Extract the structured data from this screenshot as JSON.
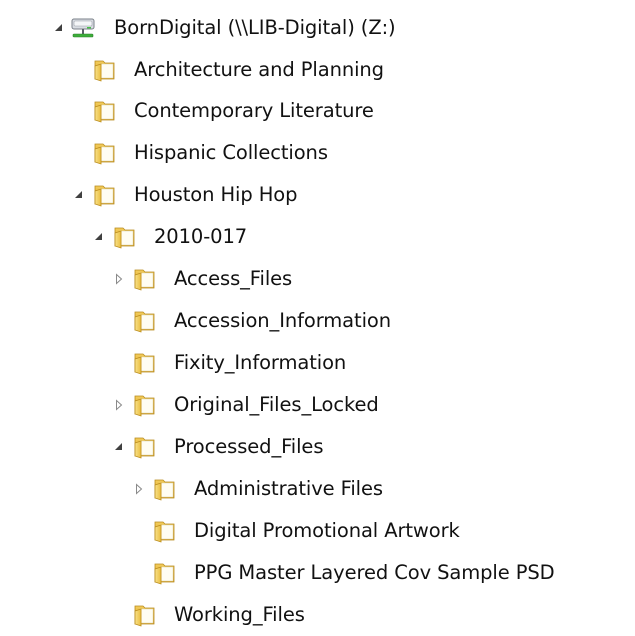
{
  "tree": {
    "root": {
      "label": "BornDigital (\\\\LIB-Digital) (Z:)",
      "icon": "network-drive-icon",
      "expander": "expanded"
    },
    "items": [
      {
        "label": "Architecture and Planning",
        "icon": "folder-icon",
        "expander": "none"
      },
      {
        "label": "Contemporary Literature",
        "icon": "folder-icon",
        "expander": "none"
      },
      {
        "label": "Hispanic Collections",
        "icon": "folder-icon",
        "expander": "none"
      },
      {
        "label": "Houston Hip Hop",
        "icon": "folder-icon",
        "expander": "expanded"
      },
      {
        "label": "2010-017",
        "icon": "folder-icon",
        "expander": "expanded"
      },
      {
        "label": "Access_Files",
        "icon": "folder-icon",
        "expander": "collapsed"
      },
      {
        "label": "Accession_Information",
        "icon": "folder-icon",
        "expander": "none"
      },
      {
        "label": "Fixity_Information",
        "icon": "folder-icon",
        "expander": "none"
      },
      {
        "label": "Original_Files_Locked",
        "icon": "folder-icon",
        "expander": "collapsed"
      },
      {
        "label": "Processed_Files",
        "icon": "folder-icon",
        "expander": "expanded"
      },
      {
        "label": "Administrative Files",
        "icon": "folder-icon",
        "expander": "collapsed"
      },
      {
        "label": "Digital Promotional Artwork",
        "icon": "folder-icon",
        "expander": "none"
      },
      {
        "label": "PPG Master Layered Cov Sample PSD",
        "icon": "folder-icon",
        "expander": "none"
      },
      {
        "label": "Working_Files",
        "icon": "folder-icon",
        "expander": "none"
      }
    ]
  },
  "colors": {
    "folder_body": "#e8b93a",
    "folder_front": "#f7d774",
    "folder_page": "#fffdf0",
    "expander_expanded": "#404040",
    "expander_collapsed": "#8a8a8a",
    "drive_green": "#3cae3a"
  }
}
